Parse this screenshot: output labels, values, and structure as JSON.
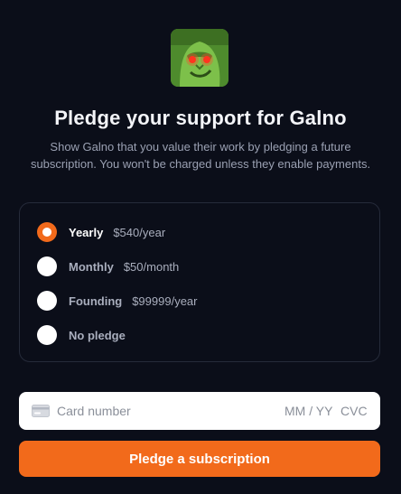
{
  "creator": {
    "avatar_icon": "creator-avatar",
    "name": "Galno"
  },
  "header": {
    "title": "Pledge your support for Galno",
    "subtitle": "Show Galno that you value their work by pledging a future subscription. You won't be charged unless they enable payments."
  },
  "plans": [
    {
      "name": "Yearly",
      "price": "$540/year",
      "selected": true
    },
    {
      "name": "Monthly",
      "price": "$50/month",
      "selected": false
    },
    {
      "name": "Founding",
      "price": "$99999/year",
      "selected": false
    },
    {
      "name": "No pledge",
      "price": "",
      "selected": false
    }
  ],
  "card": {
    "icon": "credit-card-icon",
    "number_placeholder": "Card number",
    "expiry_placeholder": "MM / YY",
    "cvc_placeholder": "CVC"
  },
  "submit": {
    "label": "Pledge a subscription"
  },
  "colors": {
    "background": "#0b0e19",
    "accent": "#f26a1b",
    "border": "#262b3a"
  }
}
